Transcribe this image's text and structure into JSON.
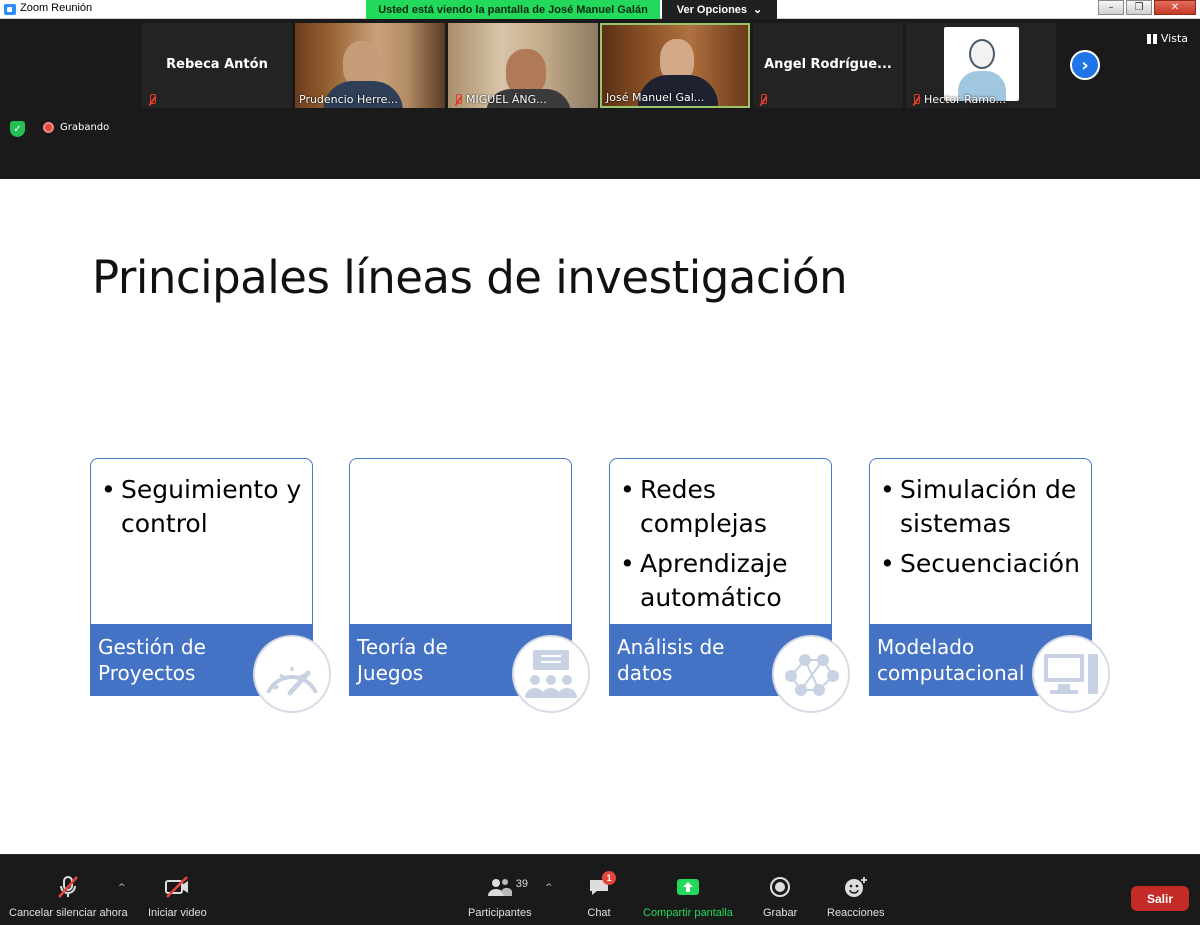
{
  "window": {
    "title": "Zoom Reunión",
    "viewing_banner": "Usted está viendo la pantalla de José Manuel Galán",
    "view_options": "Ver Opciones",
    "view_options_caret": "⌄",
    "minimize": "–",
    "maximize": "❐",
    "close": "✕"
  },
  "participants": [
    {
      "name": "Rebeca Antón",
      "label": "",
      "muted": true
    },
    {
      "name": "",
      "label": "Prudencio Herre...",
      "muted": false
    },
    {
      "name": "",
      "label": "MIGUEL ÁNG...",
      "muted": true
    },
    {
      "name": "",
      "label": "José Manuel Gal...",
      "muted": false
    },
    {
      "name": "Angel  Rodrígue...",
      "label": "",
      "muted": true
    },
    {
      "name": "",
      "label": "Hector Ramo...",
      "muted": true
    }
  ],
  "strip": {
    "next_arrow": "›",
    "vista_label": "Vista",
    "recording_label": "Grabando",
    "security_glyph": "✓"
  },
  "slide": {
    "title": "Principales líneas de investigación",
    "cards": [
      {
        "bullets": [
          "Seguimiento y control"
        ],
        "label_line1": "Gestión de",
        "label_line2": "Proyectos",
        "icon": "speedometer-icon"
      },
      {
        "bullets": [],
        "label_line1": "Teoría de",
        "label_line2": "Juegos",
        "icon": "presentation-audience-icon"
      },
      {
        "bullets": [
          "Redes complejas",
          "Aprendizaje automático"
        ],
        "label_line1": "Análisis de",
        "label_line2": "datos",
        "icon": "network-icon"
      },
      {
        "bullets": [
          "Simulación de sistemas",
          "Secuenciación"
        ],
        "label_line1": "Modelado",
        "label_line2": "computacional",
        "icon": "computer-icon"
      }
    ]
  },
  "toolbar": {
    "unmute": "Cancelar silenciar ahora",
    "start_video": "Iniciar video",
    "participants": "Participantes",
    "participants_count": "39",
    "chat": "Chat",
    "chat_badge": "1",
    "share_screen": "Compartir pantalla",
    "record": "Grabar",
    "reactions": "Reacciones",
    "leave": "Salir",
    "caret": "^"
  },
  "colors": {
    "banner_green": "#23d95b",
    "slide_blue": "#4472c4",
    "leave_red": "#c42b26",
    "accent_blue": "#1f74e8"
  }
}
